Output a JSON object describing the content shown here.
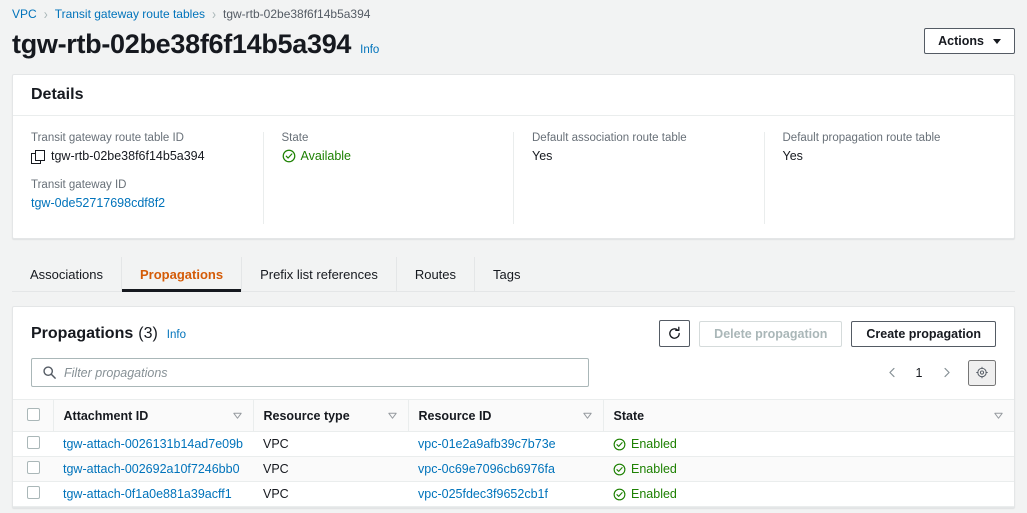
{
  "breadcrumb": {
    "items": [
      {
        "label": "VPC",
        "link": true
      },
      {
        "label": "Transit gateway route tables",
        "link": true
      },
      {
        "label": "tgw-rtb-02be38f6f14b5a394",
        "link": false
      }
    ],
    "separator": "›"
  },
  "header": {
    "title": "tgw-rtb-02be38f6f14b5a394",
    "info_label": "Info",
    "actions_label": "Actions"
  },
  "details": {
    "title": "Details",
    "fields": [
      {
        "label": "Transit gateway route table ID",
        "value": "tgw-rtb-02be38f6f14b5a394",
        "icon": "copy-icon",
        "kind": "copyable"
      },
      {
        "label": "Transit gateway ID",
        "value": "tgw-0de52717698cdf8f2",
        "kind": "link"
      },
      {
        "label": "State",
        "value": "Available",
        "kind": "status",
        "icon": "check-circle-icon",
        "color": "#1d8102"
      },
      {
        "label": "Default association route table",
        "value": "Yes",
        "kind": "text"
      },
      {
        "label": "Default propagation route table",
        "value": "Yes",
        "kind": "text"
      }
    ]
  },
  "tabs": [
    {
      "label": "Associations",
      "active": false
    },
    {
      "label": "Propagations",
      "active": true
    },
    {
      "label": "Prefix list references",
      "active": false
    },
    {
      "label": "Routes",
      "active": false
    },
    {
      "label": "Tags",
      "active": false
    }
  ],
  "propagations": {
    "title": "Propagations",
    "count": "(3)",
    "info_label": "Info",
    "refresh_icon": "refresh-icon",
    "delete_label": "Delete propagation",
    "delete_disabled": true,
    "create_label": "Create propagation",
    "search": {
      "placeholder": "Filter propagations",
      "value": "",
      "icon": "search-icon"
    },
    "pagination": {
      "prev_icon": "chevron-left-icon",
      "page": "1",
      "next_icon": "chevron-right-icon",
      "settings_icon": "gear-icon"
    },
    "columns": [
      {
        "label": "Attachment ID",
        "sortable": true
      },
      {
        "label": "Resource type",
        "sortable": true
      },
      {
        "label": "Resource ID",
        "sortable": true
      },
      {
        "label": "State",
        "sortable": true
      }
    ],
    "rows": [
      {
        "attachment_id": "tgw-attach-0026131b14ad7e09b",
        "resource_type": "VPC",
        "resource_id": "vpc-01e2a9afb39c7b73e",
        "state": "Enabled"
      },
      {
        "attachment_id": "tgw-attach-002692a10f7246bb0",
        "resource_type": "VPC",
        "resource_id": "vpc-0c69e7096cb6976fa",
        "state": "Enabled"
      },
      {
        "attachment_id": "tgw-attach-0f1a0e881a39acff1",
        "resource_type": "VPC",
        "resource_id": "vpc-025fdec3f9652cb1f",
        "state": "Enabled"
      }
    ]
  },
  "colors": {
    "link": "#0073bb",
    "active_tab": "#d45b07",
    "success": "#1d8102",
    "page_bg": "#f2f3f3"
  }
}
